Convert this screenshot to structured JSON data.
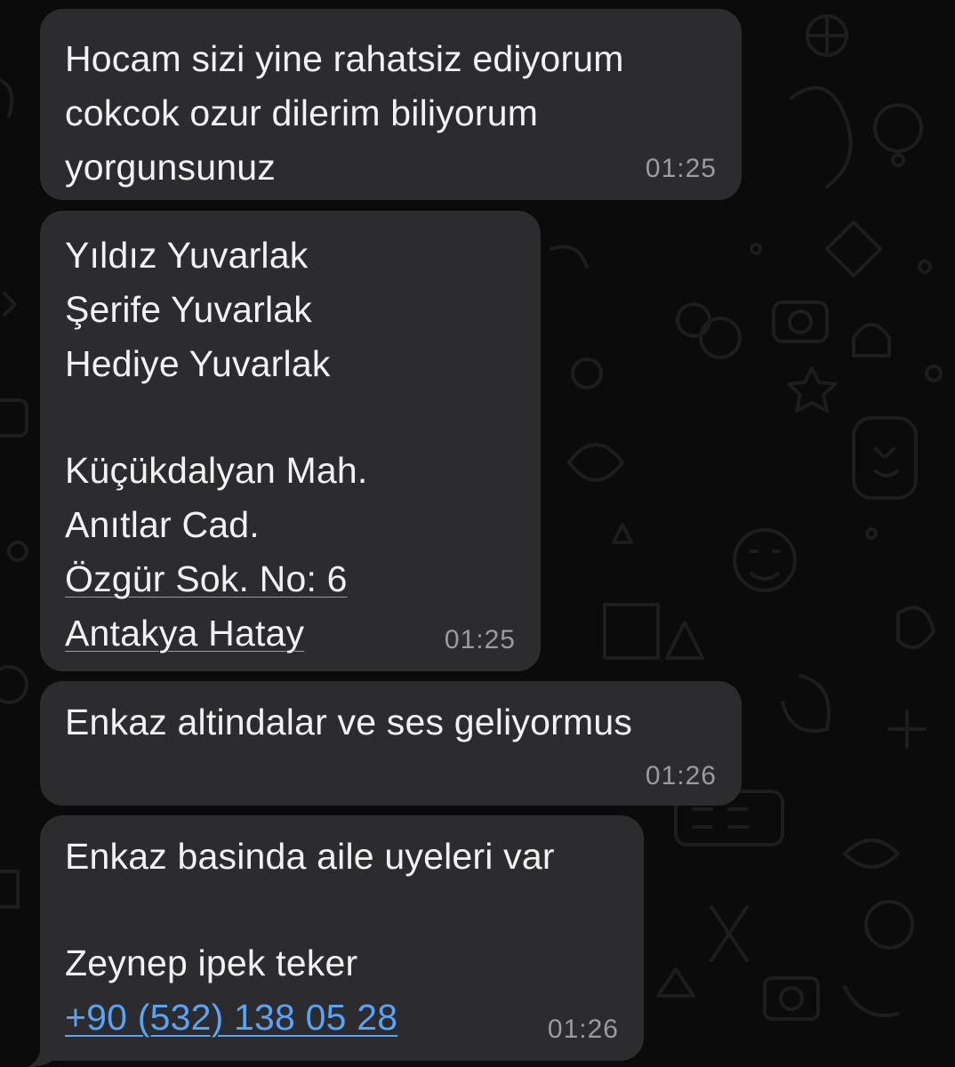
{
  "wallpaper": {
    "background_color": "#0b0b0b",
    "doodle_color": "#1e1e1e"
  },
  "colors": {
    "bubble": "#2c2c2e",
    "text": "#f2f2f2",
    "time": "#9b9b9f",
    "link": "#5aa2f5"
  },
  "messages": [
    {
      "lines": [
        "Hocam sizi yine rahatsiz ediyorum",
        "cokcok ozur dilerim biliyorum",
        "yorgunsunuz"
      ],
      "time": "01:25"
    },
    {
      "lines": [
        "Yıldız Yuvarlak",
        "Şerife Yuvarlak",
        "Hediye Yuvarlak",
        "",
        "Küçükdalyan Mah.",
        "Anıtlar Cad.",
        "Özgür Sok. No: 6",
        "Antakya Hatay"
      ],
      "time": "01:25"
    },
    {
      "lines": [
        "Enkaz altindalar ve ses geliyormus"
      ],
      "time": "01:26"
    },
    {
      "lines": [
        "Enkaz basinda aile uyeleri var",
        "",
        "Zeynep ipek teker",
        "+90 (532) 138 05 28"
      ],
      "time": "01:26"
    }
  ]
}
